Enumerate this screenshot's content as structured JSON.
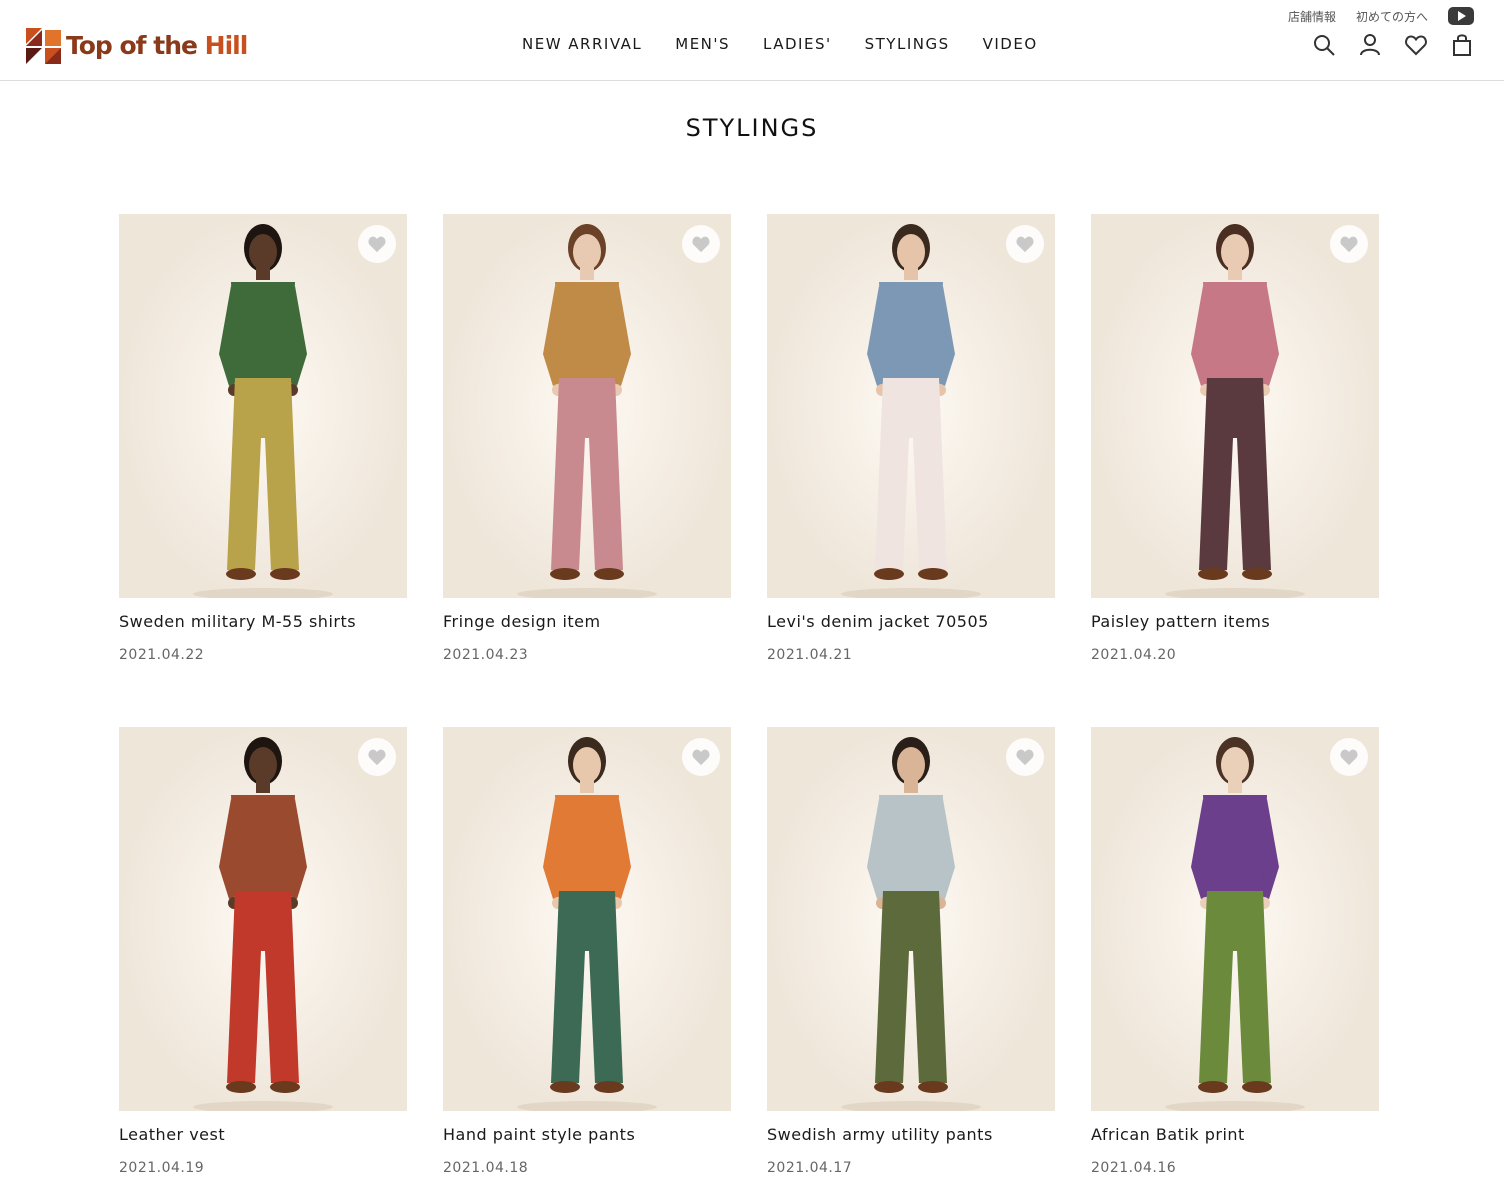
{
  "brand": {
    "name_part1": "Top of the ",
    "name_part2": "Hill"
  },
  "nav": {
    "items": [
      "NEW ARRIVAL",
      "MEN'S",
      "LADIES'",
      "STYLINGS",
      "VIDEO"
    ]
  },
  "utility": {
    "links": [
      "店舗情報",
      "初めての方へ"
    ],
    "icons": [
      "youtube-icon",
      "search-icon",
      "account-icon",
      "wishlist-icon",
      "cart-icon"
    ]
  },
  "page": {
    "title": "STYLINGS"
  },
  "stylings": [
    {
      "title": "Sweden military M-55 shirts",
      "date": "2021.04.22",
      "top": "#3f6b3b",
      "bottom": "#b8a24a",
      "skin": "#5a3a28",
      "hair": "#1e1410"
    },
    {
      "title": "Fringe design item",
      "date": "2021.04.23",
      "top": "#c08a47",
      "bottom": "#c98a8f",
      "skin": "#e8c9b2",
      "hair": "#6b4228"
    },
    {
      "title": "Levi's denim jacket 70505",
      "date": "2021.04.21",
      "top": "#7d98b5",
      "bottom": "#efe4e0",
      "skin": "#e6c4aa",
      "hair": "#3a2a1e"
    },
    {
      "title": "Paisley pattern items",
      "date": "2021.04.20",
      "top": "#c77886",
      "bottom": "#5a3a3e",
      "skin": "#e9cbb4",
      "hair": "#4a2e22"
    },
    {
      "title": "Leather vest",
      "date": "2021.04.19",
      "top": "#9a4a2e",
      "bottom": "#c0392b",
      "skin": "#5a3a28",
      "hair": "#1e1410"
    },
    {
      "title": "Hand paint style pants",
      "date": "2021.04.18",
      "top": "#e07a34",
      "bottom": "#3d6a55",
      "skin": "#e8c8ac",
      "hair": "#3b2a1e"
    },
    {
      "title": "Swedish army utility pants",
      "date": "2021.04.17",
      "top": "#b8c3c8",
      "bottom": "#5d6a3c",
      "skin": "#d9b496",
      "hair": "#2a1f18"
    },
    {
      "title": "African Batik print",
      "date": "2021.04.16",
      "top": "#6b3f8c",
      "bottom": "#6b8a3c",
      "skin": "#ead0b8",
      "hair": "#4a3224"
    }
  ]
}
